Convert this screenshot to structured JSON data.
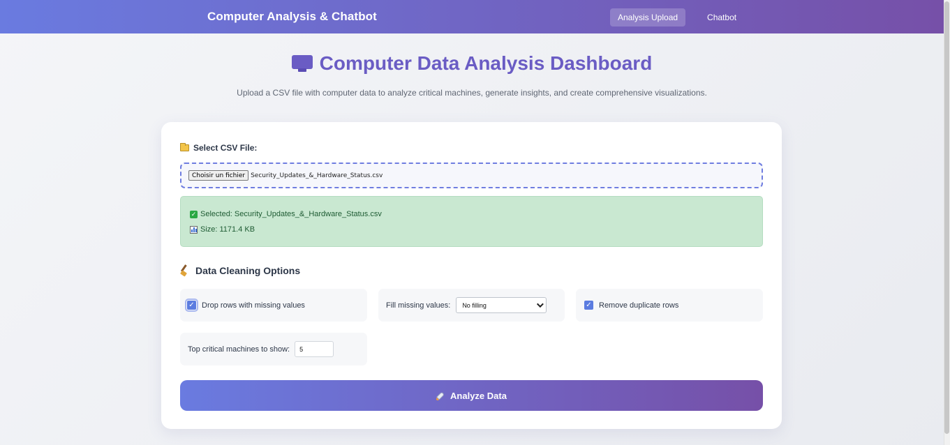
{
  "navbar": {
    "brand": "Computer Analysis & Chatbot",
    "links": [
      {
        "label": "Analysis Upload",
        "active": true
      },
      {
        "label": "Chatbot",
        "active": false
      }
    ]
  },
  "hero": {
    "icon": "monitor-icon",
    "title": "Computer Data Analysis Dashboard",
    "subtitle": "Upload a CSV file with computer data to analyze critical machines, generate insights, and create comprehensive visualizations."
  },
  "upload": {
    "label": "Select CSV File:",
    "label_icon": "folder-icon",
    "file_button": "Choisir un fichier",
    "file_name": "Security_Updates_&_Hardware_Status.csv",
    "selected_text": "Selected: Security_Updates_&_Hardware_Status.csv",
    "size_text": "Size: 1171.4 KB"
  },
  "cleaning": {
    "title": "Data Cleaning Options",
    "title_icon": "broom-icon",
    "drop_missing": {
      "label": "Drop rows with missing values",
      "checked": true
    },
    "fill_missing": {
      "label": "Fill missing values:",
      "selected": "No filling"
    },
    "remove_duplicates": {
      "label": "Remove duplicate rows",
      "checked": true
    },
    "top_critical": {
      "label": "Top critical machines to show:",
      "value": "5"
    }
  },
  "action": {
    "label": "Analyze Data",
    "icon": "rocket-icon"
  },
  "colors": {
    "accent_start": "#6a7be0",
    "accent_end": "#7650a8",
    "title": "#6a5cc4",
    "success_bg": "#c9e8d1"
  }
}
